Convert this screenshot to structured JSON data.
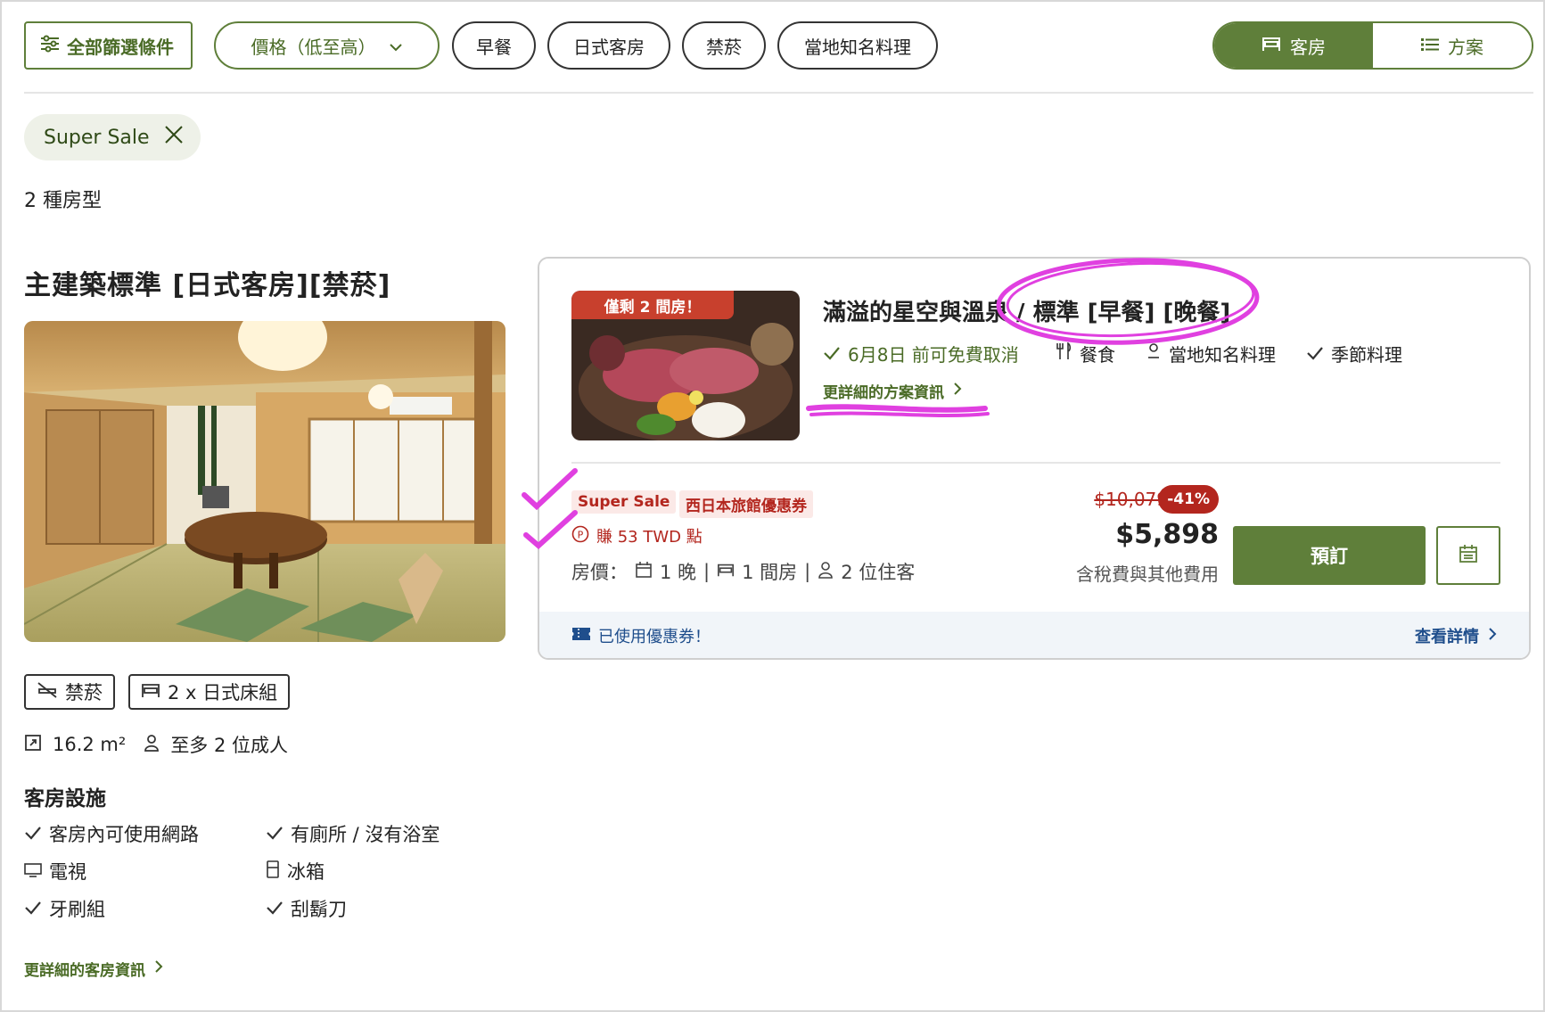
{
  "filters": {
    "all_filters_label": "全部篩選條件",
    "sort_label": "價格（低至高）",
    "pills": [
      "早餐",
      "日式客房",
      "禁菸",
      "當地知名料理"
    ]
  },
  "view_toggle": {
    "rooms_label": "客房",
    "plans_label": "方案"
  },
  "active_chip": "Super Sale",
  "room_count": "2 種房型",
  "room": {
    "title": "主建築標準 [日式客房][禁菸]",
    "tags": [
      "禁菸",
      "2 x 日式床組"
    ],
    "size": "16.2 m²",
    "occupancy": "至多 2 位成人",
    "amenities_title": "客房設施",
    "amenities": [
      "客房內可使用網路",
      "有廁所 / 沒有浴室",
      "電視",
      "冰箱",
      "牙刷組",
      "刮鬍刀"
    ],
    "more_link": "更詳細的客房資訊"
  },
  "plan": {
    "badge": "僅剩 2 間房！",
    "title": "滿溢的星空與溫泉 / 標準 [早餐] [晚餐]",
    "features": [
      "6月8日 前可免費取消",
      "餐食",
      "當地知名料理",
      "季節料理"
    ],
    "more_link": "更詳細的方案資訊",
    "sale_badge": "Super Sale",
    "coupon_badge": "西日本旅館優惠券",
    "points": "賺 53 TWD 點",
    "room_price_label": "房價：",
    "nights": "1 晚",
    "rooms": "1 間房",
    "guests": "2 位住客",
    "old_price": "$10,079",
    "discount": "-41%",
    "price": "$5,898",
    "tax_note": "含稅費與其他費用",
    "book_label": "預訂",
    "coupon_used": "已使用優惠券！",
    "view_details": "查看詳情"
  },
  "colors": {
    "brand_green": "#5f7f3a",
    "sale_red": "#b3261e",
    "link_blue": "#1f4e8c",
    "annotation_magenta": "#e040e0"
  }
}
